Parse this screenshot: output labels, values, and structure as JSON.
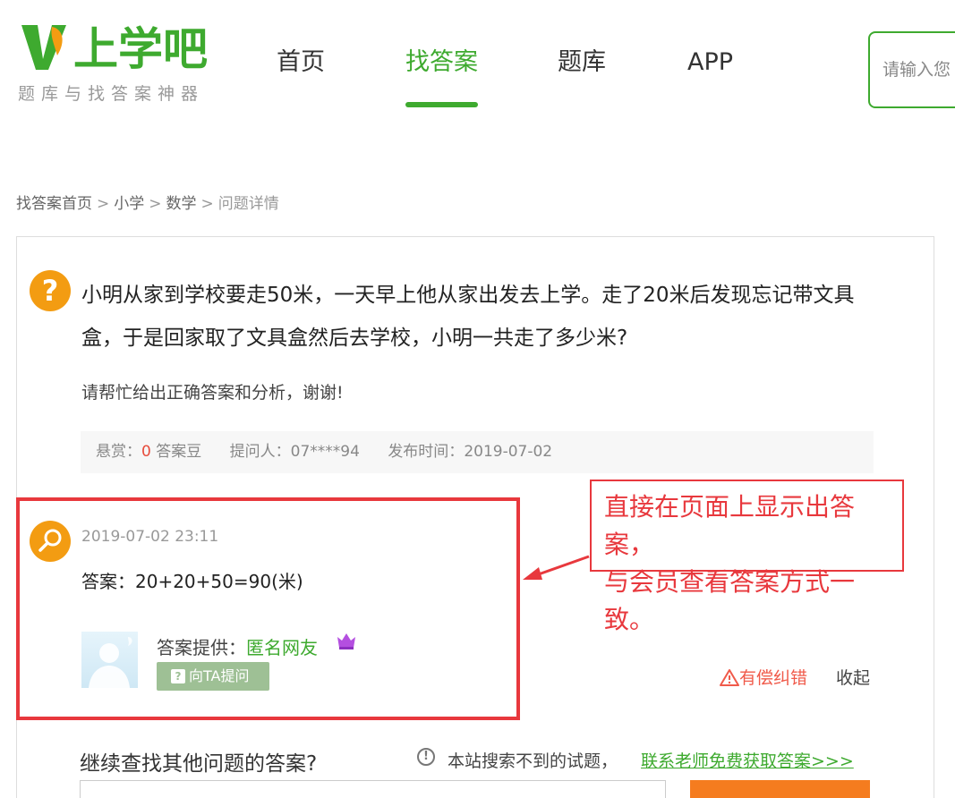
{
  "header": {
    "logo_name": "上学吧",
    "logo_slogan": "题库与找答案神器",
    "nav": [
      "首页",
      "找答案",
      "题库",
      "APP"
    ],
    "active_nav": "找答案",
    "search_placeholder": "请输入您"
  },
  "breadcrumb": [
    "找答案首页",
    "小学",
    "数学",
    "问题详情"
  ],
  "question": {
    "text": "小明从家到学校要走50米，一天早上他从家出发去上学。走了20米后发现忘记带文具盒，于是回家取了文具盒然后去学校，小明一共走了多少米?",
    "note": "请帮忙给出正确答案和分析，谢谢!",
    "reward_label": "悬赏：",
    "reward_value": "0",
    "reward_unit": "答案豆",
    "asker_label": "提问人：",
    "asker": "07****94",
    "time_label": "发布时间：",
    "time": "2019-07-02"
  },
  "answer": {
    "time": "2019-07-02 23:11",
    "text": "答案：20+20+50=90(米)",
    "provider_label": "答案提供：",
    "provider": "匿名网友",
    "ask_button": "向TA提问",
    "report": "有偿纠错",
    "collapse": "收起"
  },
  "annotation": {
    "line1": "直接在页面上显示出答案，",
    "line2": "与会员查看答案方式一致。"
  },
  "bottom": {
    "continue_title": "继续查找其他问题的答案?",
    "notice": "本站搜索不到的试题，",
    "contact_link": "联系老师免费获取答案>>>"
  },
  "colors": {
    "brand_green": "#3eaa2f",
    "orange": "#f39c12",
    "annotation_red": "#e8383d"
  }
}
